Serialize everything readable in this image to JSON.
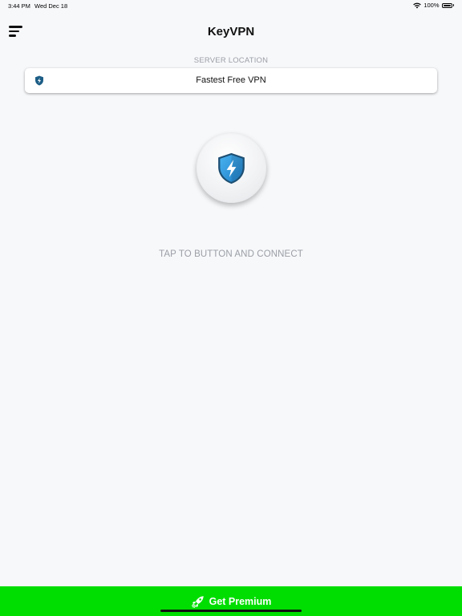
{
  "status_bar": {
    "time": "3:44 PM",
    "date": "Wed Dec 18",
    "battery": "100%",
    "icons": [
      "wifi-icon",
      "battery-icon"
    ]
  },
  "header": {
    "title": "KeyVPN",
    "menu_icon": "menu-icon"
  },
  "server": {
    "section_label": "SERVER LOCATION",
    "selected": "Fastest Free VPN",
    "icon": "shield-bolt-icon"
  },
  "connect": {
    "icon": "shield-bolt-icon",
    "hint": "TAP TO BUTTON AND CONNECT"
  },
  "premium": {
    "label": "Get Premium",
    "icon": "rocket-icon"
  },
  "colors": {
    "background": "#f7f8fa",
    "accent_blue": "#2a8fd8",
    "premium_green": "#00dd00",
    "muted_text": "#9a9ea5"
  }
}
